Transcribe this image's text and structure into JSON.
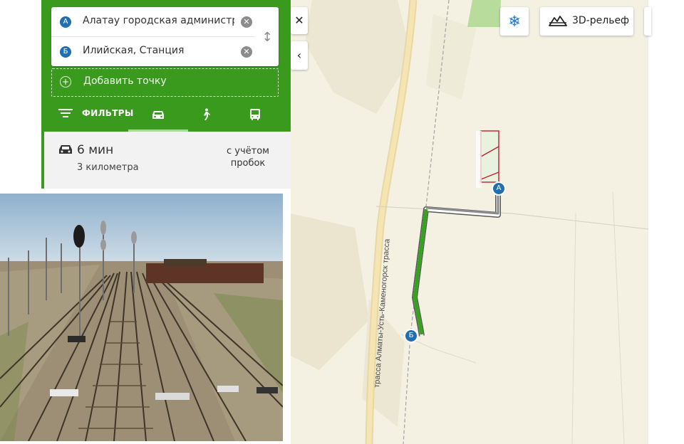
{
  "route_panel": {
    "point_a": {
      "marker": "А",
      "value": "Алатау городская администрация"
    },
    "point_b": {
      "marker": "Б",
      "value": "Илийская, Станция"
    },
    "add_point_label": "Добавить точку"
  },
  "filters": {
    "label": "ФИЛЬТРЫ",
    "modes": [
      {
        "name": "car",
        "icon": "car-icon",
        "active": true
      },
      {
        "name": "walk",
        "icon": "pedestrian-icon",
        "active": false
      },
      {
        "name": "transit",
        "icon": "bus-icon",
        "active": false
      }
    ]
  },
  "result": {
    "time": "6 мин",
    "distance": "3 километра",
    "traffic_line1": "с учётом",
    "traffic_line2": "пробок"
  },
  "map": {
    "road_label": "трасса Алматы-Усть-Каменогорск трасса",
    "marker_a": "А",
    "marker_b": "Б",
    "relief_button": "3D-рельеф",
    "route_color": "#33a41c"
  },
  "colors": {
    "panel_green": "#3a9a1e",
    "marker_blue": "#1f6fb2",
    "map_bg": "#f4f1e3"
  }
}
